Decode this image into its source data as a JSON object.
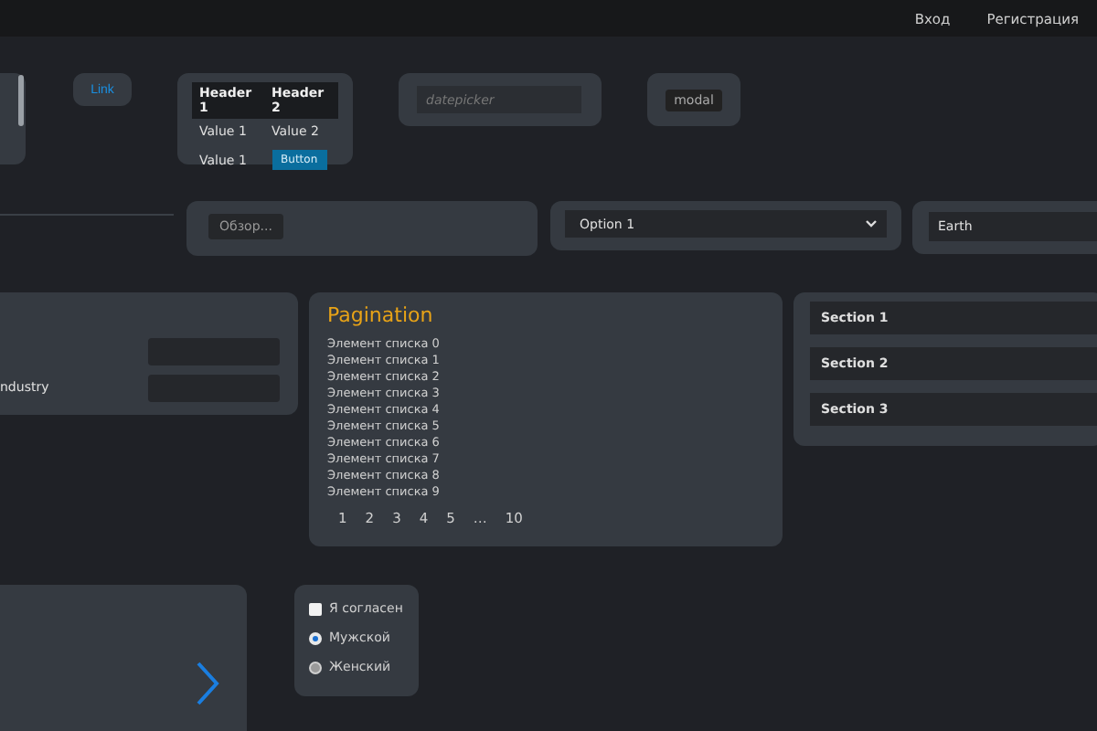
{
  "nav": {
    "links": [
      "Вход",
      "Регистрация"
    ]
  },
  "link_button": "Link",
  "table": {
    "columns": [
      "Header 1",
      "Header 2"
    ],
    "rows": [
      {
        "cells": [
          {
            "kind": "text",
            "text": "Value 1"
          },
          {
            "kind": "text",
            "text": "Value 2"
          }
        ]
      },
      {
        "cells": [
          {
            "kind": "text",
            "text": "Value 1"
          },
          {
            "kind": "button",
            "text": "Button"
          }
        ]
      }
    ]
  },
  "datepicker": {
    "placeholder": "datepicker"
  },
  "modal_button": "modal",
  "file_button": "Обзор...",
  "select": {
    "value": "Option 1"
  },
  "text_field": {
    "value": "Earth"
  },
  "form": {
    "label": "ndustry"
  },
  "pagination": {
    "title": "Pagination",
    "items": [
      "Элемент списка 0",
      "Элемент списка 1",
      "Элемент списка 2",
      "Элемент списка 3",
      "Элемент списка 4",
      "Элемент списка 5",
      "Элемент списка 6",
      "Элемент списка 7",
      "Элемент списка 8",
      "Элемент списка 9"
    ],
    "pages": [
      "1",
      "2",
      "3",
      "4",
      "5",
      "…",
      "10"
    ]
  },
  "accordion": {
    "sections": [
      "Section 1",
      "Section 2",
      "Section 3"
    ]
  },
  "checkbox": {
    "label": "Я согласен",
    "checked": false
  },
  "radios": [
    {
      "label": "Мужской",
      "selected": true
    },
    {
      "label": "Женский",
      "selected": false
    }
  ]
}
